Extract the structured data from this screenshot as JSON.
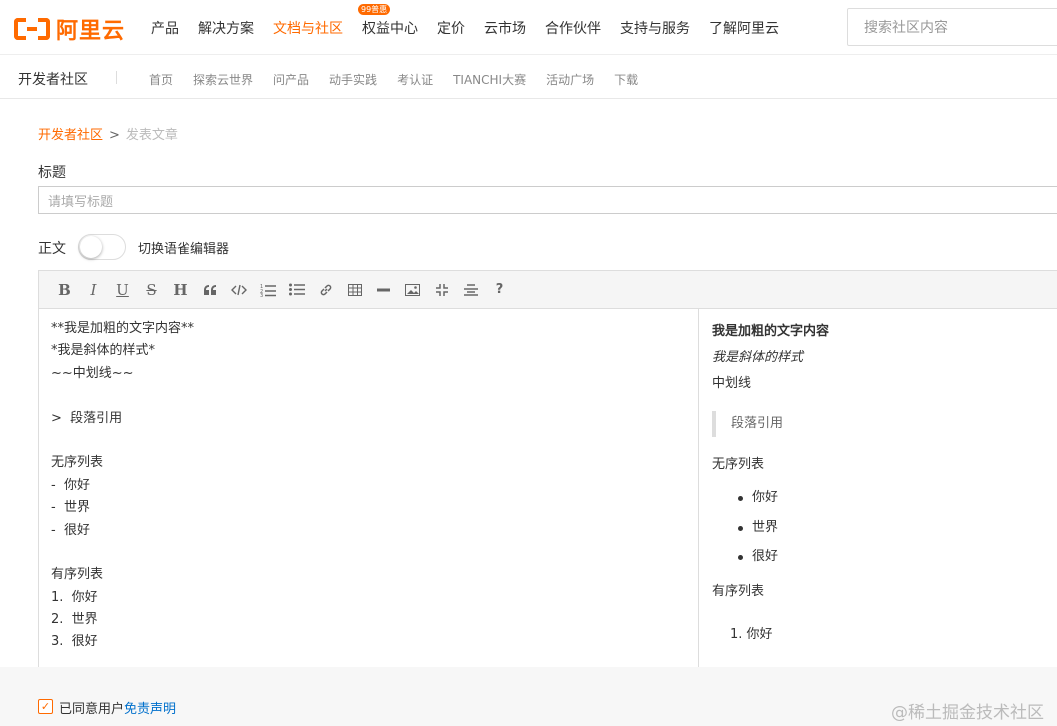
{
  "brand": {
    "name": "阿里云",
    "color": "#ff6a00"
  },
  "nav": {
    "items": [
      {
        "label": "产品"
      },
      {
        "label": "解决方案"
      },
      {
        "label": "文档与社区"
      },
      {
        "label": "权益中心",
        "badge": "99普惠"
      },
      {
        "label": "定价"
      },
      {
        "label": "云市场"
      },
      {
        "label": "合作伙伴"
      },
      {
        "label": "支持与服务"
      },
      {
        "label": "了解阿里云"
      }
    ],
    "active_index": 2
  },
  "search": {
    "placeholder": "搜索社区内容"
  },
  "subnav": {
    "title": "开发者社区",
    "items": [
      "首页",
      "探索云世界",
      "问产品",
      "动手实践",
      "考认证",
      "TIANCHI大赛",
      "活动广场",
      "下载"
    ]
  },
  "breadcrumb": {
    "home": "开发者社区",
    "separator": ">",
    "current": "发表文章"
  },
  "form": {
    "title_label": "标题",
    "title_placeholder": "请填写标题",
    "body_label": "正文",
    "toggle_label": "切换语雀编辑器",
    "toggle_on": false
  },
  "toolbar": {
    "buttons": [
      {
        "name": "bold",
        "glyph": "B"
      },
      {
        "name": "italic",
        "glyph": "I"
      },
      {
        "name": "underline",
        "glyph": "U"
      },
      {
        "name": "strikethrough",
        "glyph": "S"
      },
      {
        "name": "heading",
        "glyph": "H"
      },
      {
        "name": "quote",
        "glyph": "❝"
      },
      {
        "name": "code",
        "glyph": "</>"
      },
      {
        "name": "ordered-list",
        "glyph": "1≡"
      },
      {
        "name": "unordered-list",
        "glyph": "•≡"
      },
      {
        "name": "link",
        "glyph": "🔗"
      },
      {
        "name": "table",
        "glyph": "▦"
      },
      {
        "name": "hr",
        "glyph": "—"
      },
      {
        "name": "image",
        "glyph": "▨"
      },
      {
        "name": "fullscreen",
        "glyph": "⤡"
      },
      {
        "name": "align",
        "glyph": "≡"
      },
      {
        "name": "help",
        "glyph": "?"
      }
    ]
  },
  "source_lines": [
    "**我是加粗的文字内容**",
    "*我是斜体的样式*",
    "~~中划线~~",
    "",
    ">  段落引用",
    "",
    "无序列表",
    "-  你好",
    "-  世界",
    "-  很好",
    "",
    "有序列表",
    "1.  你好",
    "2.  世界",
    "3.  很好"
  ],
  "preview": {
    "bold": "我是加粗的文字内容",
    "italic": "我是斜体的样式",
    "strike": "中划线",
    "quote": "段落引用",
    "ul_title": "无序列表",
    "ul_items": [
      "你好",
      "世界",
      "很好"
    ],
    "ol_title": "有序列表",
    "ol_first": "1. 你好"
  },
  "footer": {
    "agree_text": "已同意用户",
    "agree_link": "免责声明",
    "checked": true,
    "watermark": "@稀土掘金技术社区"
  }
}
